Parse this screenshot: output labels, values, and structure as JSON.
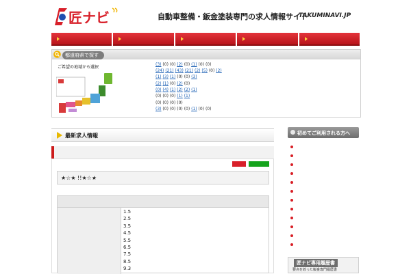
{
  "header": {
    "logo_text": "匠ナビ",
    "tagline": "自動車整備・鈑金塗装専門の求人情報サイト",
    "domain": "TAKUMINAVI.JP"
  },
  "nav": {
    "items": [
      "",
      "",
      "",
      "",
      ""
    ]
  },
  "region_search": {
    "title": "都道府県で探す",
    "map_label": "ご希望の地域から選択",
    "rows": [
      {
        "region": "",
        "cities": [
          {
            "name": "",
            "count": "(3)",
            "link": true
          },
          {
            "name": "",
            "count": "(0)",
            "link": false
          },
          {
            "name": "",
            "count": "(0)",
            "link": false
          },
          {
            "name": "",
            "count": "(2)",
            "link": true
          },
          {
            "name": "",
            "count": "(0)",
            "link": false
          },
          {
            "name": "",
            "count": "(1)",
            "link": true
          },
          {
            "name": "",
            "count": "(0)",
            "link": false
          },
          {
            "name": "",
            "count": "(0)",
            "link": false
          }
        ]
      },
      {
        "region": "",
        "cities": [
          {
            "name": "",
            "count": "(24)",
            "link": true
          },
          {
            "name": "",
            "count": "(21)",
            "link": true
          },
          {
            "name": "",
            "count": "(43)",
            "link": true
          },
          {
            "name": "",
            "count": "(21)",
            "link": true
          },
          {
            "name": "",
            "count": "(2)",
            "link": true
          },
          {
            "name": "",
            "count": "(5)",
            "link": true
          },
          {
            "name": "",
            "count": "(0)",
            "link": false
          },
          {
            "name": "",
            "count": "(2)",
            "link": true
          }
        ]
      },
      {
        "region": "",
        "cities": [
          {
            "name": "",
            "count": "(1)",
            "link": true
          },
          {
            "name": "",
            "count": "(3)",
            "link": true
          },
          {
            "name": "",
            "count": "(1)",
            "link": true
          },
          {
            "name": "",
            "count": "(0)",
            "link": false
          },
          {
            "name": "",
            "count": "(0)",
            "link": false
          },
          {
            "name": "",
            "count": "(3)",
            "link": true
          }
        ]
      },
      {
        "region": "",
        "cities": [
          {
            "name": "",
            "count": "(2)",
            "link": true
          },
          {
            "name": "",
            "count": "(1)",
            "link": true
          },
          {
            "name": "",
            "count": "(0)",
            "link": false
          },
          {
            "name": "",
            "count": "(2)",
            "link": true
          },
          {
            "name": "",
            "count": "(0)",
            "link": false
          }
        ]
      },
      {
        "region": "",
        "cities": [
          {
            "name": "",
            "count": "(0)",
            "link": true
          },
          {
            "name": "",
            "count": "(4)",
            "link": true
          },
          {
            "name": "",
            "count": "(1)",
            "link": true
          },
          {
            "name": "",
            "count": "(2)",
            "link": true
          },
          {
            "name": "",
            "count": "(2)",
            "link": true
          },
          {
            "name": "",
            "count": "(1)",
            "link": true
          }
        ]
      },
      {
        "region": "",
        "cities": [
          {
            "name": "",
            "count": "(0)",
            "link": false
          },
          {
            "name": "",
            "count": "(0)",
            "link": false
          },
          {
            "name": "",
            "count": "(0)",
            "link": false
          },
          {
            "name": "",
            "count": "(1)",
            "link": true
          },
          {
            "name": "",
            "count": "(1)",
            "link": true
          }
        ]
      },
      {
        "region": "",
        "cities": [
          {
            "name": "",
            "count": "(0)",
            "link": false
          },
          {
            "name": "",
            "count": "(0)",
            "link": false
          },
          {
            "name": "",
            "count": "(0)",
            "link": false
          },
          {
            "name": "",
            "count": "(0)",
            "link": false
          }
        ]
      },
      {
        "region": "",
        "cities": [
          {
            "name": "",
            "count": "(3)",
            "link": true
          },
          {
            "name": "",
            "count": "(0)",
            "link": false
          },
          {
            "name": "",
            "count": "(0)",
            "link": false
          },
          {
            "name": "",
            "count": "(0)",
            "link": false
          },
          {
            "name": "",
            "count": "(0)",
            "link": false
          },
          {
            "name": "",
            "count": "(1)",
            "link": true
          },
          {
            "name": "",
            "count": "(0)",
            "link": false
          },
          {
            "name": "",
            "count": "(0)",
            "link": false
          }
        ]
      }
    ]
  },
  "latest": {
    "title": "最新求人情報",
    "job_link": "",
    "badge_new": "",
    "badge_type": "",
    "catch": "★☆★ !!★☆★",
    "detail_header": "",
    "detail_key": "",
    "detail_items": [
      "1.5",
      "2.5",
      "3.5",
      "4.5",
      "5.5",
      "6.5",
      "7.5",
      "8.5",
      "9.3"
    ]
  },
  "sidebar": {
    "title": "初めてご利用される方へ",
    "items": [
      "",
      "",
      "",
      "",
      "",
      "",
      "",
      "",
      "",
      "",
      "",
      ""
    ],
    "banner_title": "匠ナビ専用履歴書",
    "banner_sub": "要点を絞った鈑金専門履歴書"
  },
  "colors": {
    "brand_red": "#d8202a",
    "nav_gradient_top": "#e4343b",
    "link_blue": "#1a5fb4",
    "badge_green": "#15a41c"
  }
}
